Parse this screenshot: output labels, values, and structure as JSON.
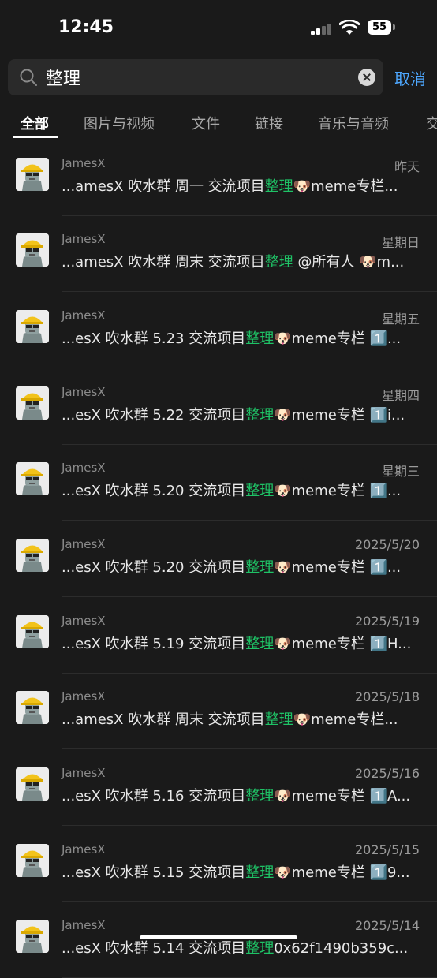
{
  "status": {
    "time": "12:45",
    "battery": "55"
  },
  "search": {
    "query": "整理",
    "cancel_label": "取消"
  },
  "tabs": [
    {
      "label": "全部"
    },
    {
      "label": "图片与视频"
    },
    {
      "label": "文件"
    },
    {
      "label": "链接"
    },
    {
      "label": "音乐与音频"
    },
    {
      "label": "交"
    }
  ],
  "results": [
    {
      "sender": "JamesX",
      "date": "昨天",
      "pre": "...amesX 吹水群 周一 交流项目",
      "hl": "整理",
      "post": "🐶meme专栏..."
    },
    {
      "sender": "JamesX",
      "date": "星期日",
      "pre": "...amesX 吹水群 周末 交流项目",
      "hl": "整理",
      "post": " @所有人 🐶m..."
    },
    {
      "sender": "JamesX",
      "date": "星期五",
      "pre": "...esX 吹水群 5.23 交流项目",
      "hl": "整理",
      "post": "🐶meme专栏 1️⃣..."
    },
    {
      "sender": "JamesX",
      "date": "星期四",
      "pre": "...esX 吹水群 5.22 交流项目",
      "hl": "整理",
      "post": "🐶meme专栏 1️⃣i..."
    },
    {
      "sender": "JamesX",
      "date": "星期三",
      "pre": "...esX 吹水群 5.20 交流项目",
      "hl": "整理",
      "post": "🐶meme专栏 1️⃣..."
    },
    {
      "sender": "JamesX",
      "date": "2025/5/20",
      "pre": "...esX 吹水群 5.20 交流项目",
      "hl": "整理",
      "post": "🐶meme专栏 1️⃣..."
    },
    {
      "sender": "JamesX",
      "date": "2025/5/19",
      "pre": "...esX 吹水群 5.19 交流项目",
      "hl": "整理",
      "post": "🐶meme专栏 1️⃣H..."
    },
    {
      "sender": "JamesX",
      "date": "2025/5/18",
      "pre": "...amesX 吹水群 周末 交流项目",
      "hl": "整理",
      "post": "🐶meme专栏..."
    },
    {
      "sender": "JamesX",
      "date": "2025/5/16",
      "pre": "...esX 吹水群 5.16 交流项目",
      "hl": "整理",
      "post": "🐶meme专栏 1️⃣A..."
    },
    {
      "sender": "JamesX",
      "date": "2025/5/15",
      "pre": "...esX 吹水群 5.15 交流项目",
      "hl": "整理",
      "post": "🐶meme专栏 1️⃣9..."
    },
    {
      "sender": "JamesX",
      "date": "2025/5/14",
      "pre": "...esX 吹水群 5.14 交流项目",
      "hl": "整理",
      "post": "0x62f1490b359c..."
    }
  ],
  "colors": {
    "background": "#1a1a1a",
    "highlight": "#1fc266",
    "cancel": "#4ea8ff"
  }
}
